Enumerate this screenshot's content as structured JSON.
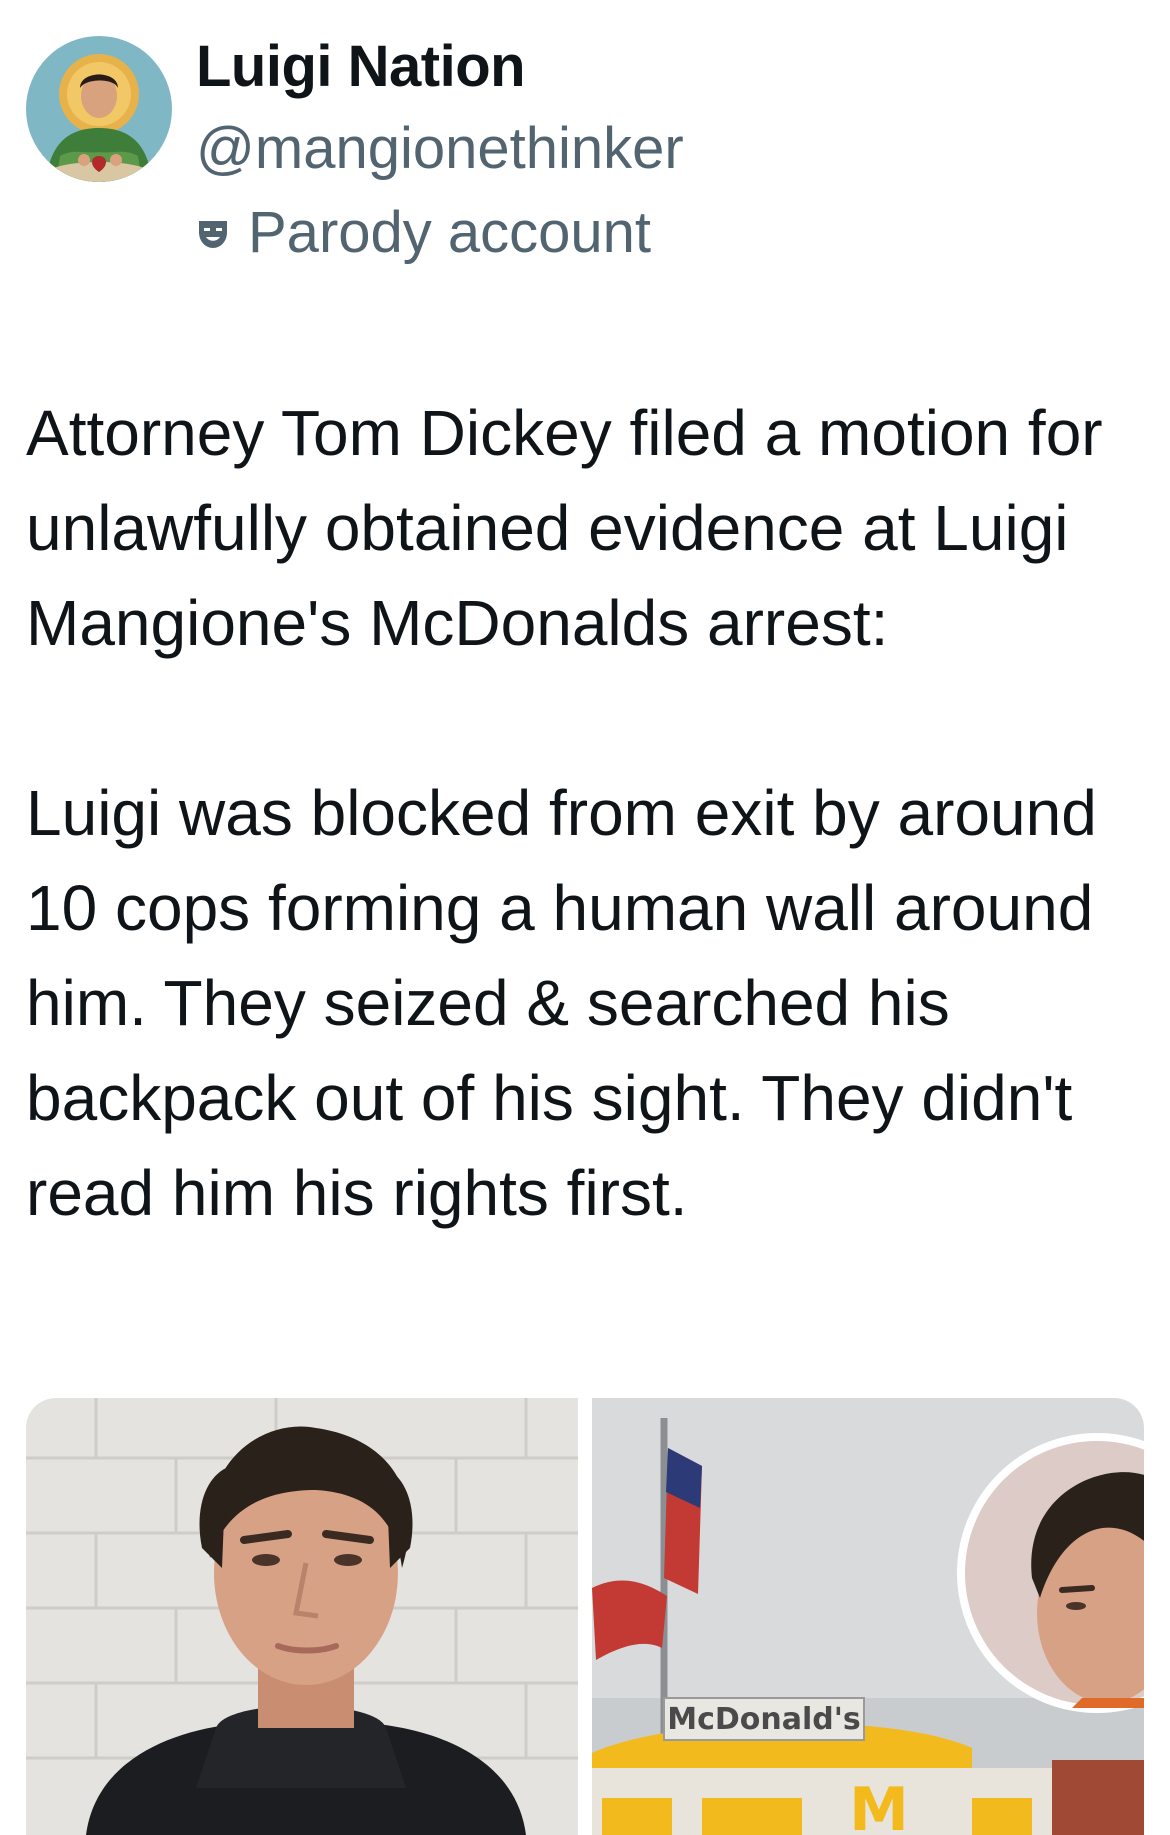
{
  "author": {
    "display_name": "Luigi Nation",
    "handle": "@mangionethinker",
    "label_icon": "theater-mask-icon",
    "label": "Parody account"
  },
  "tweet": {
    "paragraphs": [
      "Attorney Tom Dickey filed a motion for unlawfully obtained evidence at Luigi Mangione's McDonalds arrest:",
      "Luigi was blocked from exit by around 10 cops forming a human wall around him. They seized & searched his backpack out of his sight. They didn't read him his rights first."
    ]
  },
  "media": {
    "photo_2_sign": "McDonald's",
    "photo_2_logo": "M"
  },
  "colors": {
    "text_primary": "#0f1419",
    "text_secondary": "#536471",
    "background": "#ffffff"
  }
}
